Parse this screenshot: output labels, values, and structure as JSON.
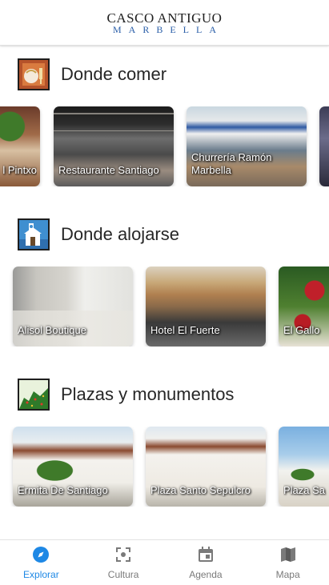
{
  "header": {
    "logo_top": "CASCO ANTIGUO",
    "logo_bottom": "MARBELLA"
  },
  "sections": [
    {
      "title": "Donde comer",
      "icon": "restaurant-icon",
      "cards": [
        {
          "label": "l Pintxo"
        },
        {
          "label": "Restaurante Santiago"
        },
        {
          "label": "Churrería Ramón Marbella"
        },
        {
          "label": ""
        }
      ]
    },
    {
      "title": "Donde alojarse",
      "icon": "hotel-icon",
      "cards": [
        {
          "label": "Alisol Boutique"
        },
        {
          "label": "Hotel El Fuerte"
        },
        {
          "label": "El Gallo"
        }
      ]
    },
    {
      "title": "Plazas y monumentos",
      "icon": "monument-icon",
      "cards": [
        {
          "label": "Ermita De Santiago"
        },
        {
          "label": "Plaza Santo Sepulcro"
        },
        {
          "label": "Plaza Sa"
        }
      ]
    }
  ],
  "tabs": [
    {
      "label": "Explorar",
      "icon": "compass-icon",
      "active": true
    },
    {
      "label": "Cultura",
      "icon": "scan-icon",
      "active": false
    },
    {
      "label": "Agenda",
      "icon": "calendar-icon",
      "active": false
    },
    {
      "label": "Mapa",
      "icon": "map-icon",
      "active": false
    }
  ],
  "colors": {
    "accent": "#1e88e5",
    "inactive": "#7a7a7a",
    "logo_blue": "#2a5ea8"
  }
}
